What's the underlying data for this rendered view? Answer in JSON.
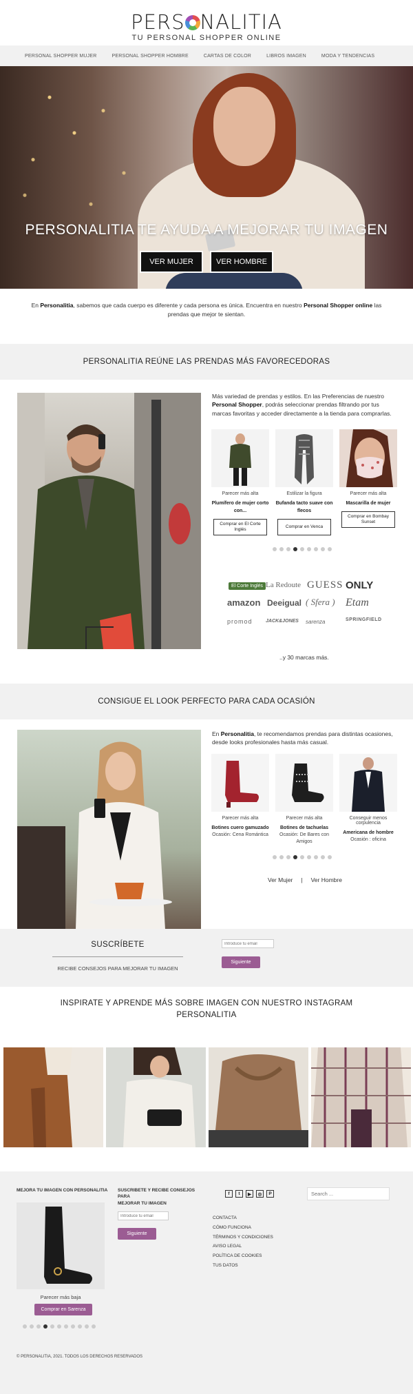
{
  "header": {
    "logo_main_left": "PERS",
    "logo_main_right": "NALITIA",
    "logo_sub": "TU PERSONAL  SHOPPER ONLINE"
  },
  "nav": [
    "PERSONAL SHOPPER MUJER",
    "PERSONAL SHOPPER HOMBRE",
    "CARTAS DE COLOR",
    "LIBROS IMAGEN",
    "MODA Y TENDENCIAS"
  ],
  "hero": {
    "title": "PERSONALITIA TE AYUDA A MEJORAR TU IMAGEN",
    "btn_women": "VER MUJER",
    "btn_men": "VER HOMBRE"
  },
  "intro": {
    "p1": "En ",
    "brand": "Personalitia",
    "p2": ", sabemos que cada cuerpo es diferente y cada persona es única. Encuentra en nuestro ",
    "shopper": "Personal Shopper online",
    "p3": " las prendas que mejor te sientan."
  },
  "section1": {
    "heading": "PERSONALITIA REÚNE LAS PRENDAS MÁS FAVORECEDORAS",
    "desc_a": "Más variedad de prendas y estilos. En las Preferencias de nuestro ",
    "desc_b": "Personal Shopper",
    "desc_c": ", podrás seleccionar prendas filtrando por tus marcas favoritas y acceder directamente a la tienda para comprarlas.",
    "products": [
      {
        "label": "Parecer más alta",
        "name": "Plumífero de mujer corto con...",
        "buy": "Comprar en El Corte Inglés"
      },
      {
        "label": "Estilizar la figura",
        "name": "Bufanda tacto suave con flecos",
        "buy": "Comprar en Venca"
      },
      {
        "label": "Parecer más alta",
        "name": "Mascarilla de mujer",
        "buy": "Comprar en Bombay Sunset"
      }
    ],
    "brands": [
      "El Corte Inglés",
      "La Redoute",
      "GUESS",
      "ONLY",
      "amazon",
      "Deeigual",
      "( Sfera )",
      "Etam",
      "promod",
      "JACK&JONES",
      "sarenza",
      "SPRINGFIELD"
    ],
    "more_brands": "..y 30 marcas más."
  },
  "section2": {
    "heading": "CONSIGUE EL LOOK PERFECTO PARA CADA OCASIÓN",
    "desc_a": "En ",
    "desc_b": "Personalitia",
    "desc_c": ", te recomendamos prendas para distintas ocasiones, desde looks profesionales hasta más casual.",
    "products": [
      {
        "label": "Parecer más alta",
        "name": "Botines cuero gamuzado",
        "occasion": "Ocasión: Cena Romántica"
      },
      {
        "label": "Parecer más alta",
        "name": "Botines de tachuelas",
        "occasion": "Ocasión: De Bares con Amigos"
      },
      {
        "label": "Conseguir menos corpulencia",
        "name": "Americana de hombre",
        "occasion": "Ocasión : oficina"
      }
    ],
    "link_women": "Ver Mujer",
    "separator": "|",
    "link_men": "Ver Hombre"
  },
  "subscribe": {
    "title": "SUSCRÍBETE",
    "desc": "RECIBE CONSEJOS PARA MEJORAR TU IMAGEN",
    "email_placeholder": "Introduce tu email",
    "button": "Siguiente"
  },
  "instagram": {
    "title_line1": "INSPIRATE Y APRENDE MÁS SOBRE IMAGEN CON NUESTRO INSTAGRAM",
    "title_line2": "PERSONALITIA"
  },
  "footer": {
    "col1_title": "MEJORA TU IMAGEN CON PERSONALITIA",
    "col1_label": "Parecer más baja",
    "col1_button": "Comprar en Sarenza",
    "col2_title_1": "SUSCRIBETE Y RECIBE CONSEJOS PARA",
    "col2_title_2": "MEJORAR TU IMAGEN",
    "col2_placeholder": "Introduce tu email",
    "col2_button": "Siguiente",
    "social": [
      "f",
      "t",
      "▶",
      "◎",
      "P"
    ],
    "links": [
      "CONTACTA",
      "CÓMO FUNCIONA",
      "TÉRMINOS Y CONDICIONES",
      "AVISO LEGAL",
      "POLÍTICA DE COOKIES",
      "TUS DATOS"
    ],
    "search_placeholder": "Search ...",
    "copyright": "© PERSONALITIA, 2021. TODOS LOS DERECHOS RESERVADOS"
  },
  "colors": {
    "accent_purple": "#9b5c93",
    "band_gray": "#f1f1f1",
    "dark": "#111111"
  }
}
